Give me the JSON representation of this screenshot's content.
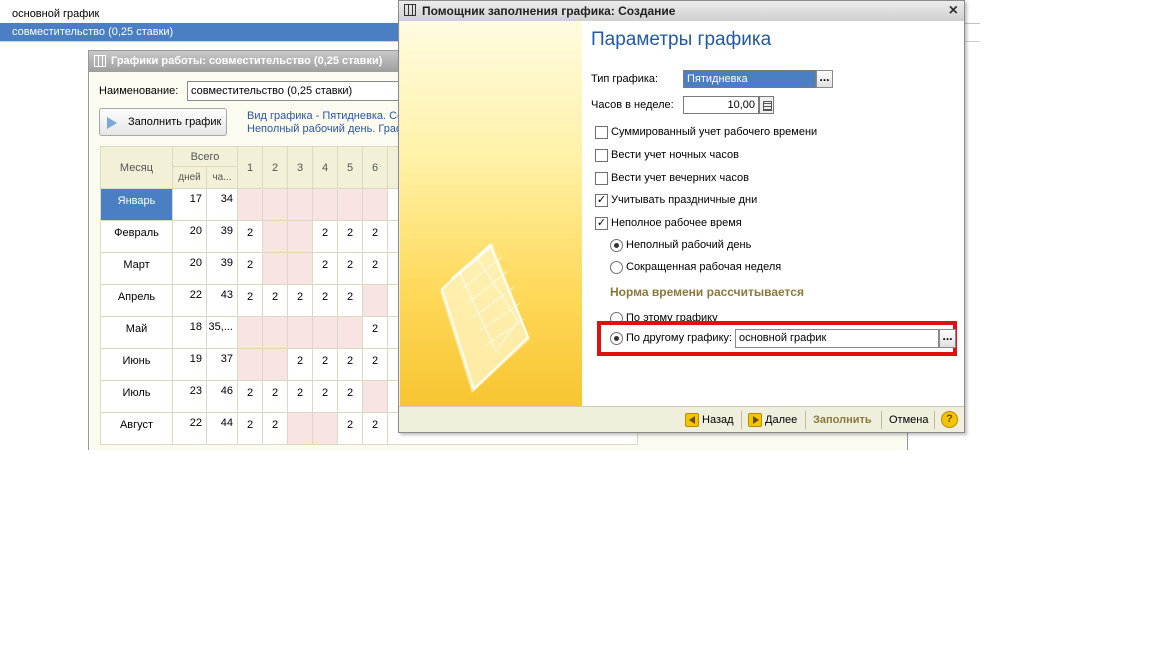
{
  "background_list": {
    "items": [
      "основной график",
      "совместительство (0,25 ставки)"
    ]
  },
  "schedules_window": {
    "title": "Графики работы: совместительство (0,25 ставки)",
    "name_label": "Наименование:",
    "name_value": "совместительство (0,25 ставки)",
    "fill_button": "Заполнить график",
    "info_line1": "Вид графика - Пятидневка. Со",
    "info_line2": "Неполный рабочий день. Граф",
    "table": {
      "headers": {
        "month": "Месяц",
        "total": "Всего",
        "days": "дней",
        "hours": "ча...",
        "day_cols": [
          "1",
          "2",
          "3",
          "4",
          "5",
          "6"
        ]
      },
      "rows": [
        {
          "month": "Январь",
          "days": "17",
          "hours": "34",
          "cells": [
            "",
            "",
            "",
            "",
            "",
            ""
          ]
        },
        {
          "month": "Февраль",
          "days": "20",
          "hours": "39",
          "cells": [
            "2",
            "",
            "",
            "2",
            "2",
            "2"
          ]
        },
        {
          "month": "Март",
          "days": "20",
          "hours": "39",
          "cells": [
            "2",
            "",
            "",
            "2",
            "2",
            "2"
          ]
        },
        {
          "month": "Апрель",
          "days": "22",
          "hours": "43",
          "cells": [
            "2",
            "2",
            "2",
            "2",
            "2",
            ""
          ]
        },
        {
          "month": "Май",
          "days": "18",
          "hours": "35,...",
          "cells": [
            "",
            "",
            "",
            "",
            "",
            "2"
          ]
        },
        {
          "month": "Июнь",
          "days": "19",
          "hours": "37",
          "cells": [
            "",
            "",
            "2",
            "2",
            "2",
            "2"
          ]
        },
        {
          "month": "Июль",
          "days": "23",
          "hours": "46",
          "cells": [
            "2",
            "2",
            "2",
            "2",
            "2",
            ""
          ]
        },
        {
          "month": "Август",
          "days": "22",
          "hours": "44",
          "cells": [
            "2",
            "2",
            "",
            "",
            "2",
            "2"
          ]
        }
      ]
    }
  },
  "wizard": {
    "title": "Помощник заполнения графика: Создание",
    "heading": "Параметры графика",
    "type_label": "Тип графика:",
    "type_value": "Пятидневка",
    "hours_label": "Часов в неделе:",
    "hours_value": "10,00",
    "checkboxes": {
      "summed": {
        "label": "Суммированный учет рабочего времени",
        "checked": false
      },
      "night": {
        "label": "Вести учет ночных часов",
        "checked": false
      },
      "evening": {
        "label": "Вести учет вечерних часов",
        "checked": false
      },
      "holidays": {
        "label": "Учитывать праздничные дни",
        "checked": true
      },
      "part_time": {
        "label": "Неполное рабочее время",
        "checked": true
      }
    },
    "radios_parttime": {
      "day": {
        "label": "Неполный рабочий день",
        "selected": true
      },
      "week": {
        "label": "Сокращенная рабочая неделя",
        "selected": false
      }
    },
    "norm_title": "Норма времени рассчитывается",
    "radios_norm": {
      "this": {
        "label": "По этому графику",
        "selected": false
      },
      "other": {
        "label": "По другому графику:",
        "selected": true
      }
    },
    "other_schedule_value": "основной график",
    "buttons": {
      "back": "Назад",
      "next": "Далее",
      "fill": "Заполнить",
      "cancel": "Отмена"
    },
    "colors": {
      "highlight": "#e01010",
      "accent": "#1f5aa6",
      "selection": "#4a7fc3"
    }
  }
}
